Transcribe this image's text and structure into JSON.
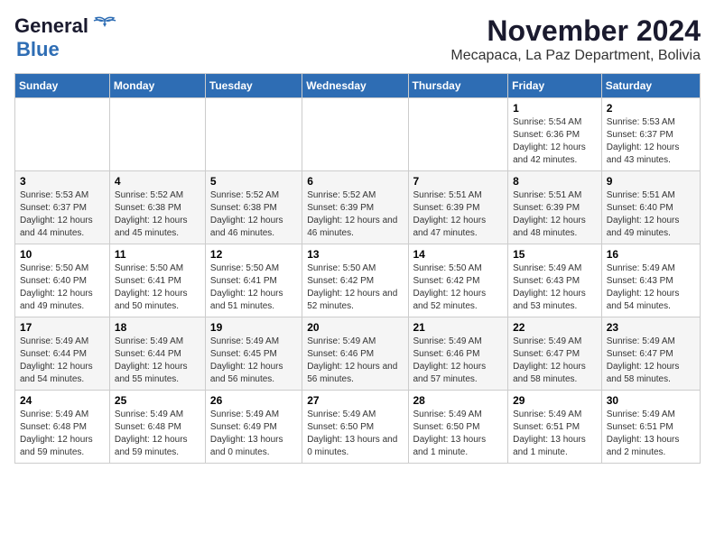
{
  "logo": {
    "line1": "General",
    "line2": "Blue"
  },
  "title": "November 2024",
  "location": "Mecapaca, La Paz Department, Bolivia",
  "weekdays": [
    "Sunday",
    "Monday",
    "Tuesday",
    "Wednesday",
    "Thursday",
    "Friday",
    "Saturday"
  ],
  "weeks": [
    [
      {
        "day": "",
        "info": ""
      },
      {
        "day": "",
        "info": ""
      },
      {
        "day": "",
        "info": ""
      },
      {
        "day": "",
        "info": ""
      },
      {
        "day": "",
        "info": ""
      },
      {
        "day": "1",
        "info": "Sunrise: 5:54 AM\nSunset: 6:36 PM\nDaylight: 12 hours and 42 minutes."
      },
      {
        "day": "2",
        "info": "Sunrise: 5:53 AM\nSunset: 6:37 PM\nDaylight: 12 hours and 43 minutes."
      }
    ],
    [
      {
        "day": "3",
        "info": "Sunrise: 5:53 AM\nSunset: 6:37 PM\nDaylight: 12 hours and 44 minutes."
      },
      {
        "day": "4",
        "info": "Sunrise: 5:52 AM\nSunset: 6:38 PM\nDaylight: 12 hours and 45 minutes."
      },
      {
        "day": "5",
        "info": "Sunrise: 5:52 AM\nSunset: 6:38 PM\nDaylight: 12 hours and 46 minutes."
      },
      {
        "day": "6",
        "info": "Sunrise: 5:52 AM\nSunset: 6:39 PM\nDaylight: 12 hours and 46 minutes."
      },
      {
        "day": "7",
        "info": "Sunrise: 5:51 AM\nSunset: 6:39 PM\nDaylight: 12 hours and 47 minutes."
      },
      {
        "day": "8",
        "info": "Sunrise: 5:51 AM\nSunset: 6:39 PM\nDaylight: 12 hours and 48 minutes."
      },
      {
        "day": "9",
        "info": "Sunrise: 5:51 AM\nSunset: 6:40 PM\nDaylight: 12 hours and 49 minutes."
      }
    ],
    [
      {
        "day": "10",
        "info": "Sunrise: 5:50 AM\nSunset: 6:40 PM\nDaylight: 12 hours and 49 minutes."
      },
      {
        "day": "11",
        "info": "Sunrise: 5:50 AM\nSunset: 6:41 PM\nDaylight: 12 hours and 50 minutes."
      },
      {
        "day": "12",
        "info": "Sunrise: 5:50 AM\nSunset: 6:41 PM\nDaylight: 12 hours and 51 minutes."
      },
      {
        "day": "13",
        "info": "Sunrise: 5:50 AM\nSunset: 6:42 PM\nDaylight: 12 hours and 52 minutes."
      },
      {
        "day": "14",
        "info": "Sunrise: 5:50 AM\nSunset: 6:42 PM\nDaylight: 12 hours and 52 minutes."
      },
      {
        "day": "15",
        "info": "Sunrise: 5:49 AM\nSunset: 6:43 PM\nDaylight: 12 hours and 53 minutes."
      },
      {
        "day": "16",
        "info": "Sunrise: 5:49 AM\nSunset: 6:43 PM\nDaylight: 12 hours and 54 minutes."
      }
    ],
    [
      {
        "day": "17",
        "info": "Sunrise: 5:49 AM\nSunset: 6:44 PM\nDaylight: 12 hours and 54 minutes."
      },
      {
        "day": "18",
        "info": "Sunrise: 5:49 AM\nSunset: 6:44 PM\nDaylight: 12 hours and 55 minutes."
      },
      {
        "day": "19",
        "info": "Sunrise: 5:49 AM\nSunset: 6:45 PM\nDaylight: 12 hours and 56 minutes."
      },
      {
        "day": "20",
        "info": "Sunrise: 5:49 AM\nSunset: 6:46 PM\nDaylight: 12 hours and 56 minutes."
      },
      {
        "day": "21",
        "info": "Sunrise: 5:49 AM\nSunset: 6:46 PM\nDaylight: 12 hours and 57 minutes."
      },
      {
        "day": "22",
        "info": "Sunrise: 5:49 AM\nSunset: 6:47 PM\nDaylight: 12 hours and 58 minutes."
      },
      {
        "day": "23",
        "info": "Sunrise: 5:49 AM\nSunset: 6:47 PM\nDaylight: 12 hours and 58 minutes."
      }
    ],
    [
      {
        "day": "24",
        "info": "Sunrise: 5:49 AM\nSunset: 6:48 PM\nDaylight: 12 hours and 59 minutes."
      },
      {
        "day": "25",
        "info": "Sunrise: 5:49 AM\nSunset: 6:48 PM\nDaylight: 12 hours and 59 minutes."
      },
      {
        "day": "26",
        "info": "Sunrise: 5:49 AM\nSunset: 6:49 PM\nDaylight: 13 hours and 0 minutes."
      },
      {
        "day": "27",
        "info": "Sunrise: 5:49 AM\nSunset: 6:50 PM\nDaylight: 13 hours and 0 minutes."
      },
      {
        "day": "28",
        "info": "Sunrise: 5:49 AM\nSunset: 6:50 PM\nDaylight: 13 hours and 1 minute."
      },
      {
        "day": "29",
        "info": "Sunrise: 5:49 AM\nSunset: 6:51 PM\nDaylight: 13 hours and 1 minute."
      },
      {
        "day": "30",
        "info": "Sunrise: 5:49 AM\nSunset: 6:51 PM\nDaylight: 13 hours and 2 minutes."
      }
    ]
  ]
}
